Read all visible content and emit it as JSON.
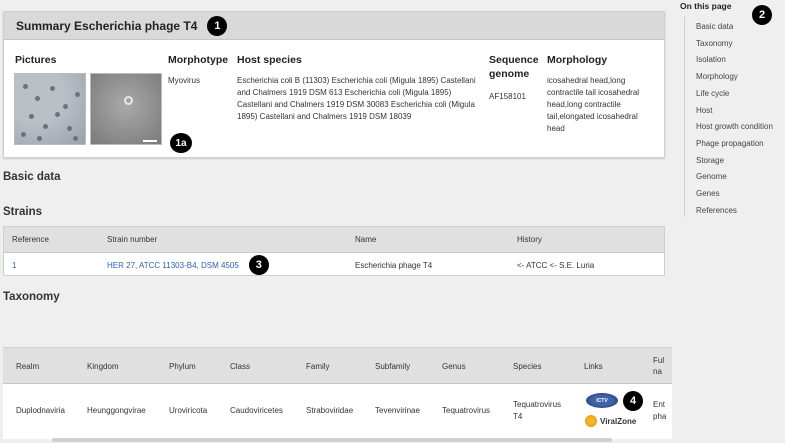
{
  "summary": {
    "title": "Summary Escherichia phage T4",
    "badge": "1",
    "pictures_label": "Pictures",
    "pictures_badge": "1a",
    "morphotype_label": "Morphotype",
    "morphotype_value": "Myovirus",
    "host_label": "Host species",
    "host_value": "Escherichia coli B (11303) Escherichia coli (Migula 1895) Castellani and Chalmers 1919 DSM 613 Escherichia coli (Migula 1895) Castellani and Chalmers 1919 DSM 30083 Escherichia coli (Migula 1895) Castellani and Chalmers 1919 DSM 18039",
    "seq_label": "Sequence genome",
    "seq_value": "AF158101",
    "morphology_label": "Morphology",
    "morphology_value": "icosahedral head,long contractile tail icosahedral head,long contractile tail,elongated icosahedral head"
  },
  "basic_data": {
    "heading": "Basic data"
  },
  "strains": {
    "heading": "Strains",
    "columns": [
      "Reference",
      "Strain number",
      "Name",
      "History"
    ],
    "row": {
      "reference": "1",
      "strain_number": "HER 27, ATCC 11303-B4, DSM 4505",
      "badge": "3",
      "name": "Escherichia phage T4",
      "history": "<- ATCC <- S.E. Luria"
    }
  },
  "taxonomy": {
    "heading": "Taxonomy",
    "columns": [
      "Realm",
      "Kingdom",
      "Phylum",
      "Class",
      "Family",
      "Subfamily",
      "Genus",
      "Species",
      "Links",
      "Ful",
      "na"
    ],
    "row": {
      "realm": "Duplodnaviria",
      "kingdom": "Heunggongvirae",
      "phylum": "Uroviricota",
      "class": "Caudoviricetes",
      "family": "Straboviridae",
      "subfamily": "Tevenvirinae",
      "genus": "Tequatrovirus",
      "species_1": "Tequatrovirus",
      "species_2": "T4",
      "ictv_label": "ICTV",
      "viralzone_label": "ViralZone",
      "badge": "4",
      "full_1": "Ent",
      "full_2": "pha"
    }
  },
  "toc": {
    "title": "On this page",
    "badge": "2",
    "items": [
      "Basic data",
      "Taxonomy",
      "Isolation",
      "Morphology",
      "Life cycle",
      "Host",
      "Host growth condition",
      "Phage propagation",
      "Storage",
      "Genome",
      "Genes",
      "References"
    ]
  }
}
